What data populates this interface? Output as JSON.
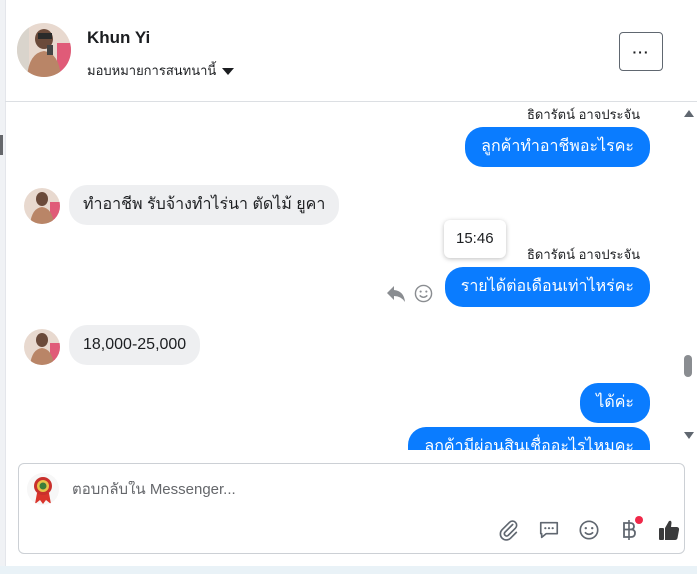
{
  "header": {
    "contact_name": "Khun Yi",
    "assign_label": "มอบหมายการสนทนานี้",
    "more_label": "···"
  },
  "messages": [
    {
      "direction": "out",
      "sender": "ธิดารัตน์ อาจประจัน",
      "text": "ลูกค้าทำอาชีพอะไรคะ"
    },
    {
      "direction": "in",
      "text": "ทำอาชีพ รับจ้างทำไร่นา  ตัดไม้ ยูคา"
    },
    {
      "direction": "out",
      "sender": "ธิดารัตน์ อาจประจัน",
      "text": "รายได้ต่อเดือนเท่าไหร่คะ",
      "time": "15:46"
    },
    {
      "direction": "in",
      "text": "18,000-25,000"
    },
    {
      "direction": "out",
      "text": "ได้ค่ะ"
    },
    {
      "direction": "out",
      "text": "ลูกค้ามีผ่อนสินเชื่ออะไรไหมคะ"
    }
  ],
  "composer": {
    "placeholder": "ตอบกลับใน Messenger..."
  },
  "colors": {
    "outgoing_bubble": "#0a7cff",
    "incoming_bubble": "#eeeff1",
    "notification_dot": "#f02849"
  },
  "icons": {
    "reply": "reply-icon",
    "react": "smiley-icon",
    "attach": "paperclip-icon",
    "saved_replies": "chat-bubble-icon",
    "emoji": "smiley-icon",
    "payment": "baht-icon",
    "like": "thumbs-up-icon"
  }
}
